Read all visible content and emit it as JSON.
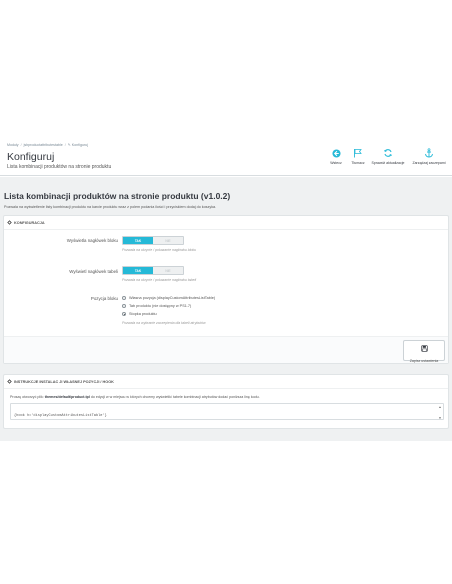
{
  "breadcrumb": {
    "items": [
      "Moduły",
      "jsbproductattributestable",
      "Konfiguruj"
    ]
  },
  "header": {
    "title": "Konfiguruj",
    "subtitle": "Lista kombinacji produktów na stronie produktu"
  },
  "toolbar": {
    "back_label": "Wstecz",
    "translate_label": "Tłumacz",
    "check_updates_label": "Sprawdź aktualizacje",
    "hooks_label": "Zarządzaj zaczepami"
  },
  "main": {
    "title": "Lista kombinacji produktów na stronie produktu (v1.0.2)",
    "description": "Pozwala na wyświetlenie listy kombinacji produktu na karcie produktu wraz z polem podania ilości i przyciskiem dodaj do koszyka."
  },
  "config_panel": {
    "heading": "Konfiguracja",
    "field1": {
      "label": "Wyświetla nagłówek bloku",
      "on": "TAK",
      "off": "NIE",
      "help": "Pozwala na ukrycie / pokazanie nagłówku bloku"
    },
    "field2": {
      "label": "Wyświetl nagłówek tabeli",
      "on": "TAK",
      "off": "NIE",
      "help": "Pozwala na ukrycie / pokazanie nagłówku tabeli"
    },
    "field3": {
      "label": "Pozycja bloku",
      "options": [
        "Własna pozycja (displayCustomAttributesListTable)",
        "Tab produktu (nie dostępny w PS1.7)",
        "Stopka produktu"
      ],
      "selected_index": 2,
      "help": "Pozwala na wybranie zaczepienia dla tabeli atrybutów"
    },
    "save_label": "Zapisz ustawienia"
  },
  "instructions_panel": {
    "heading": "Instrukcje instalac ji własnej pozycji / hook",
    "text_before": "Proszę otworzyć plik: ",
    "file": "themes/default/product.tpl",
    "text_after": " do edycji w w miejscu w których chcemy wyświetlić tabele kombinacji atrybutów dodać poniższa linę kodu.",
    "code": "{hook h='displayCustomAttributesListTable'}"
  },
  "colors": {
    "accent": "#25b9d7",
    "background": "#eff1f2",
    "text_dark": "#363a41"
  }
}
